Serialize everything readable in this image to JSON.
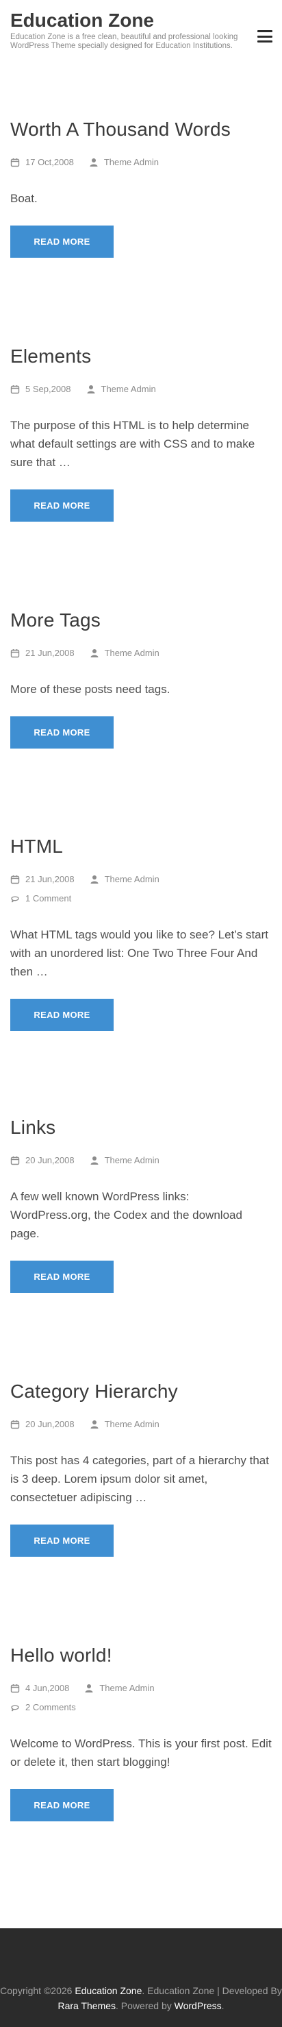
{
  "header": {
    "site_title": "Education Zone",
    "site_description": "Education Zone is a free clean, beautiful and professional looking WordPress Theme specially designed for Education Institutions."
  },
  "posts": [
    {
      "title": "Worth A Thousand Words",
      "date": "17 Oct,2008",
      "author": "Theme Admin",
      "comments": "",
      "excerpt": "Boat.",
      "button": "READ MORE"
    },
    {
      "title": "Elements",
      "date": "5 Sep,2008",
      "author": "Theme Admin",
      "comments": "",
      "excerpt": "The purpose of this HTML is to help determine what default settings are with CSS and to make sure that …",
      "button": "READ MORE"
    },
    {
      "title": "More Tags",
      "date": "21 Jun,2008",
      "author": "Theme Admin",
      "comments": "",
      "excerpt": "More of these posts need tags.",
      "button": "READ MORE"
    },
    {
      "title": "HTML",
      "date": "21 Jun,2008",
      "author": "Theme Admin",
      "comments": "1 Comment",
      "excerpt": "What HTML tags would you like to see? Let’s start with an unordered list: One Two Three Four And then …",
      "button": "READ MORE"
    },
    {
      "title": "Links",
      "date": "20 Jun,2008",
      "author": "Theme Admin",
      "comments": "",
      "excerpt": "A few well known WordPress links: WordPress.org, the Codex and the download page.",
      "button": "READ MORE"
    },
    {
      "title": "Category Hierarchy",
      "date": "20 Jun,2008",
      "author": "Theme Admin",
      "comments": "",
      "excerpt": "This post has 4 categories, part of a hierarchy that is 3 deep. Lorem ipsum dolor sit amet, consectetuer adipiscing …",
      "button": "READ MORE"
    },
    {
      "title": "Hello world!",
      "date": "4 Jun,2008",
      "author": "Theme Admin",
      "comments": "2 Comments",
      "excerpt": "Welcome to WordPress. This is your first post. Edit or delete it, then start blogging!",
      "button": "READ MORE"
    }
  ],
  "footer": {
    "copyright_prefix": "Copyright ©2026 ",
    "site_link": "Education Zone",
    "mid_text": ". Education Zone | Developed By ",
    "developer_link": "Rara Themes",
    "powered_text": ". Powered by ",
    "wordpress_link": "WordPress",
    "end_text": "."
  },
  "colors": {
    "button": "#3f8fd2",
    "footer_bg": "#2b2b2b"
  },
  "icons": {
    "date": "calendar-icon",
    "author": "user-icon",
    "comments": "comment-icon",
    "menu": "hamburger-menu-icon"
  }
}
